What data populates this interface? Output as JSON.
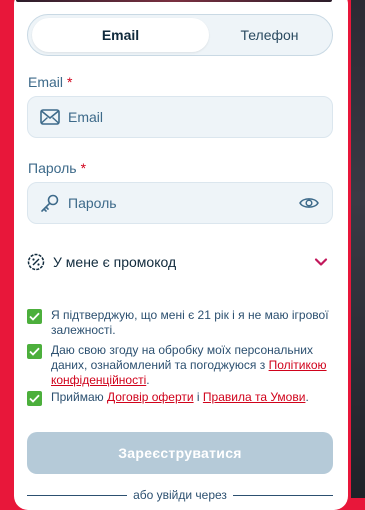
{
  "tabs": {
    "email": "Email",
    "phone": "Телефон",
    "active": "email"
  },
  "email_field": {
    "label": "Email",
    "required_mark": "*",
    "placeholder": "Email",
    "value": "",
    "icon": "envelope-icon"
  },
  "password_field": {
    "label": "Пароль",
    "required_mark": "*",
    "placeholder": "Пароль",
    "value": "",
    "icon": "key-icon",
    "toggle_icon": "eye-icon"
  },
  "promo": {
    "label": "У мене є  промокод",
    "icon": "promo-percent-icon",
    "toggle_icon": "chevron-down-icon"
  },
  "consents": {
    "age": {
      "checked": true,
      "text": "Я підтверджую, що мені є 21 рік і я не маю ігрової залежності."
    },
    "data": {
      "checked": true,
      "text_before": "Даю свою згоду на обробку моїх персональних даних, ознайомлений та погоджуюся з ",
      "link": "Політикою конфіденційності",
      "text_after": "."
    },
    "terms": {
      "checked": true,
      "text_before": "Приймаю ",
      "link1": "Договір оферти",
      "middle": " і ",
      "link2": "Правила та Умови",
      "text_after": "."
    }
  },
  "submit_label": "Зареєструватися",
  "alt_login_text": "або увійди через",
  "colors": {
    "accent": "#e8173a",
    "checkbox": "#4caf3c",
    "link": "#d0021b",
    "button_disabled": "#b5cad8",
    "label": "#3d6a8a"
  }
}
